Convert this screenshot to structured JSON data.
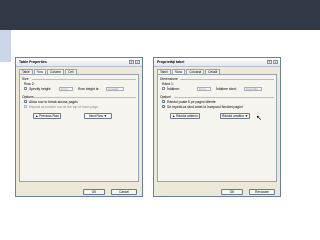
{
  "dialogs": [
    {
      "title": "Table Properties",
      "tabs": [
        "Table",
        "Row",
        "Column",
        "Cell"
      ],
      "size_label": "Size",
      "row_label": "Row 2:",
      "specify_height_label": "Specify height:",
      "height_value": "0 cm",
      "row_height_is_label": "Row height is:",
      "row_height_value": "At least",
      "options_label": "Options",
      "allow_break_label": "Allow row to break across pages",
      "allow_break_checked": "✓",
      "repeat_header_label": "Repeat as header row at the top of each page",
      "prev_button": "▲ Previous Row",
      "next_button": "Next Row ▼",
      "ok_button": "OK",
      "cancel_button": "Cancel"
    },
    {
      "title": "Proprietăţi tabel",
      "tabs": [
        "Tabel",
        "Rând",
        "Coloană",
        "Celulă"
      ],
      "size_label": "Dimensiune",
      "row_label": "Rând 1:",
      "specify_height_label": "Înălțime:",
      "height_value": "0 cm",
      "row_height_is_label": "Înălțime rând:",
      "row_height_value": "Cel puțin",
      "options_label": "Opțiuni",
      "allow_break_label": "Rândul poate fi pe pagini diferite",
      "allow_break_checked": "✓",
      "repeat_header_label": "Se repetă ca rând antet la începutul fiecărei pagini",
      "repeat_checked": "✓",
      "prev_button": "▲ Rândul anterior",
      "next_button": "Rândul următor ▼",
      "ok_button": "OK",
      "cancel_button": "Revocare"
    }
  ],
  "colors": {
    "top_stripe": "#333a47",
    "left_stripe": "#cbd6e6",
    "dialog_bg": "#ece9d8"
  }
}
